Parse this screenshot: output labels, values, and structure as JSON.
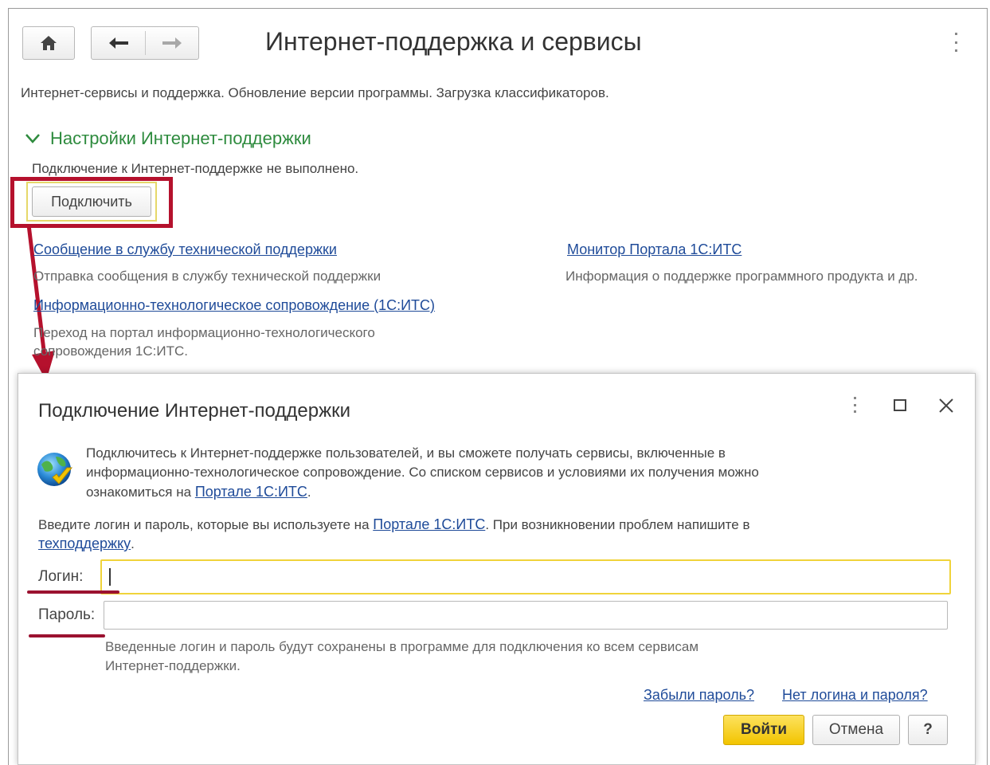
{
  "header": {
    "title": "Интернет-поддержка и сервисы",
    "home_icon": "home-icon",
    "back_icon": "arrow-left-icon",
    "forward_icon": "arrow-right-icon"
  },
  "description": "Интернет-сервисы и поддержка. Обновление версии программы. Загрузка классификаторов.",
  "settings_section": {
    "title": "Настройки Интернет-поддержки",
    "status": "Подключение к Интернет-поддержке не выполнено.",
    "connect_button": "Подключить"
  },
  "links": {
    "support_message": {
      "label": "Сообщение в службу технической поддержки",
      "desc": "Отправка сообщения в службу технической поддержки"
    },
    "its": {
      "label": "Информационно-технологическое сопровождение (1С:ИТС)",
      "desc_line1": "Переход на портал информационно-технологического",
      "desc_line2": "сопровождения 1С:ИТС."
    },
    "monitor": {
      "label": "Монитор Портала 1С:ИТС",
      "desc": "Информация о поддержке программного продукта и др."
    }
  },
  "dialog": {
    "title": "Подключение Интернет-поддержки",
    "info_line1": "Подключитесь к Интернет-поддержке пользователей, и вы сможете получать сервисы, включенные в",
    "info_line2": "информационно-технологическое сопровождение. Со списком сервисов и условиями их получения можно",
    "info_line3_prefix": "ознакомиться на ",
    "info_line3_link": "Портале 1С:ИТС",
    "info_line3_suffix": ".",
    "prompt_prefix": "Введите логин и пароль, которые вы используете на ",
    "prompt_link": "Портале 1С:ИТС",
    "prompt_suffix": ". При возникновении проблем напишите в",
    "prompt_link2": "техподдержку",
    "prompt_end": ".",
    "login_label": "Логин:",
    "login_value": "",
    "password_label": "Пароль:",
    "password_value": "",
    "note_line1": "Введенные логин и пароль будут сохранены в программе для подключения ко всем сервисам",
    "note_line2": "Интернет-поддержки.",
    "forgot_link": "Забыли пароль?",
    "no_login_link": "Нет логина и пароля?",
    "login_button": "Войти",
    "cancel_button": "Отмена",
    "help_button": "?"
  },
  "colors": {
    "accent_green": "#2e8b3e",
    "link_blue": "#1f4b99",
    "annotation_red": "#b5112d",
    "primary_yellow": "#f2c400"
  }
}
